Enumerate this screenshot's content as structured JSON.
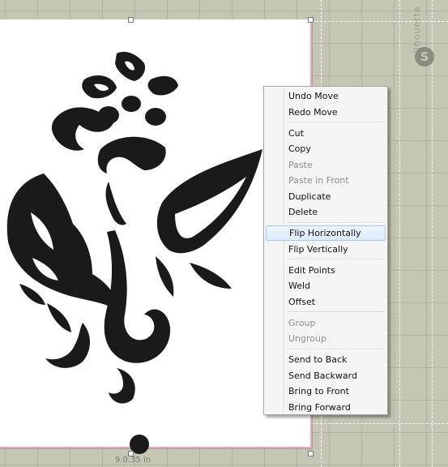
{
  "context_menu": {
    "groups": [
      [
        {
          "label": "Undo Move",
          "enabled": true
        },
        {
          "label": "Redo Move",
          "enabled": true
        }
      ],
      [
        {
          "label": "Cut",
          "enabled": true
        },
        {
          "label": "Copy",
          "enabled": true
        },
        {
          "label": "Paste",
          "enabled": false
        },
        {
          "label": "Paste in Front",
          "enabled": false
        },
        {
          "label": "Duplicate",
          "enabled": true
        },
        {
          "label": "Delete",
          "enabled": true
        }
      ],
      [
        {
          "label": "Flip Horizontally",
          "enabled": true,
          "highlighted": true
        },
        {
          "label": "Flip Vertically",
          "enabled": true
        }
      ],
      [
        {
          "label": "Edit Points",
          "enabled": true
        },
        {
          "label": "Weld",
          "enabled": true
        },
        {
          "label": "Offset",
          "enabled": true
        }
      ],
      [
        {
          "label": "Group",
          "enabled": false
        },
        {
          "label": "Ungroup",
          "enabled": false
        }
      ],
      [
        {
          "label": "Send to Back",
          "enabled": true
        },
        {
          "label": "Send Backward",
          "enabled": true
        },
        {
          "label": "Bring to Front",
          "enabled": true
        },
        {
          "label": "Bring Forward",
          "enabled": true
        }
      ]
    ]
  },
  "cutting_mat": {
    "brand": "silhouette",
    "logo_letter": "S",
    "mat_color": "#c6c6b4",
    "grid_color": "#b2b2a0"
  },
  "selection": {
    "dimension_label": "9.0.35 in"
  },
  "design": {
    "name": "floral-motif",
    "fill": "#1a1a1a"
  },
  "icons": {
    "logo": "silhouette-logo-icon"
  }
}
